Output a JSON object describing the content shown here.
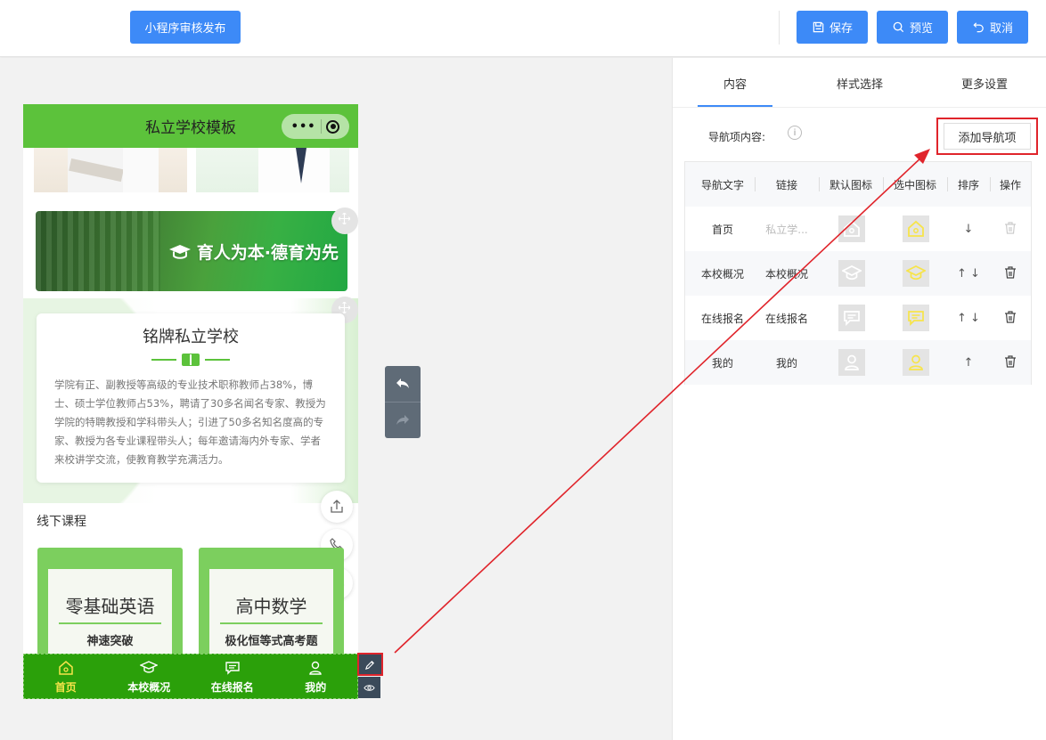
{
  "toolbar": {
    "publish_label": "小程序审核发布",
    "save_label": "保存",
    "preview_label": "预览",
    "cancel_label": "取消"
  },
  "phone": {
    "title": "私立学校模板",
    "capsule_dots": "•••",
    "banner_text": "育人为本·德育为先",
    "intro_title": "铭牌私立学校",
    "intro_text": "学院有正、副教授等高级的专业技术职称教师占38%，博士、硕士学位教师占53%，聘请了30多名闻名专家、教授为学院的特聘教授和学科带头人；引进了50多名知名度高的专家、教授为各专业课程带头人；每年邀请海内外专家、学者来校讲学交流，使教育教学充满活力。",
    "section_title": "线下课程",
    "courses": [
      {
        "title": "零基础英语",
        "subtitle": "神速突破"
      },
      {
        "title": "高中数学",
        "subtitle": "极化恒等式高考题"
      }
    ],
    "tabbar": [
      {
        "label": "首页",
        "icon": "home-icon"
      },
      {
        "label": "本校概况",
        "icon": "graduation-cap-icon"
      },
      {
        "label": "在线报名",
        "icon": "message-icon"
      },
      {
        "label": "我的",
        "icon": "user-icon"
      }
    ]
  },
  "panel": {
    "tabs": [
      "内容",
      "样式选择",
      "更多设置"
    ],
    "active_tab": "内容",
    "nav_content_label": "导航项内容:",
    "info_icon": "i",
    "add_button": "添加导航项",
    "table": {
      "headers": [
        "导航文字",
        "链接",
        "默认图标",
        "选中图标",
        "排序",
        "操作"
      ],
      "rows": [
        {
          "text": "首页",
          "link": "私立学...",
          "icon": "home-icon",
          "sort": "↓"
        },
        {
          "text": "本校概况",
          "link": "本校概况",
          "icon": "graduation-cap-icon",
          "sort": "↑ ↓"
        },
        {
          "text": "在线报名",
          "link": "在线报名",
          "icon": "message-icon",
          "sort": "↑ ↓"
        },
        {
          "text": "我的",
          "link": "我的",
          "icon": "user-icon",
          "sort": "↑"
        }
      ]
    }
  },
  "colors": {
    "accent": "#3d8af7",
    "phone_green": "#5cc23b",
    "tabbar_green": "#2ba00a",
    "active_yellow": "#f7e44a",
    "highlight_red": "#e0242b"
  }
}
